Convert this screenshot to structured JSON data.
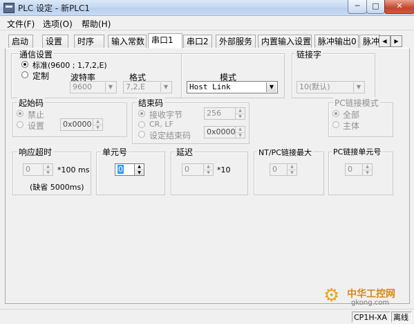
{
  "window": {
    "title": "PLC 设定 - 新PLC1",
    "min_glyph": "─",
    "max_glyph": "□",
    "close_glyph": "✕",
    "icon": "plc-app-icon"
  },
  "menu": [
    "文件(F)",
    "选项(O)",
    "帮助(H)"
  ],
  "tabs": [
    "启动",
    "设置",
    "时序",
    "输入常数",
    "串口1",
    "串口2",
    "外部服务",
    "内置输入设置",
    "脉冲输出0",
    "脉冲"
  ],
  "active_tab": "串口1",
  "tab_scroll": {
    "left": "◀",
    "right": "▶"
  },
  "comm": {
    "legend": "通信设置",
    "standard_label": "标准(9600 ; 1,7,2,E)",
    "custom_label": "定制",
    "baud_label": "波特率",
    "baud_value": "9600",
    "format_label": "格式",
    "format_value": "7,2,E",
    "mode_label": "模式",
    "mode_value": "Host Link"
  },
  "link_word": {
    "legend": "链接字",
    "value": "10(默认)"
  },
  "start_code": {
    "legend": "起始码",
    "disable_label": "禁止",
    "set_label": "设置",
    "value": "0x0000"
  },
  "end_code": {
    "legend": "结束码",
    "receive_bytes_label": "接收字节",
    "receive_bytes_value": "256",
    "crlf_label": "CR, LF",
    "set_end_label": "设定结束码",
    "set_end_value": "0x0000"
  },
  "pc_link_mode": {
    "legend": "PC链接模式",
    "all_label": "全部",
    "master_label": "主体"
  },
  "response_timeout": {
    "legend": "响应超时",
    "value": "0",
    "unit": "*100 ms",
    "default_note": "(缺省 5000ms)"
  },
  "unit_number": {
    "legend": "单元号",
    "value": "0"
  },
  "delay": {
    "legend": "延迟",
    "value": "0",
    "unit": "*10"
  },
  "nt_pc_link_max": {
    "legend": "NT/PC链接最大",
    "value": "0"
  },
  "pc_link_unit": {
    "legend": "PC链接单元号",
    "value": "0"
  },
  "status": {
    "model": "CP1H-XA",
    "connection": "离线"
  },
  "watermark": {
    "text": "中华工控网",
    "url": "gkong.com"
  }
}
